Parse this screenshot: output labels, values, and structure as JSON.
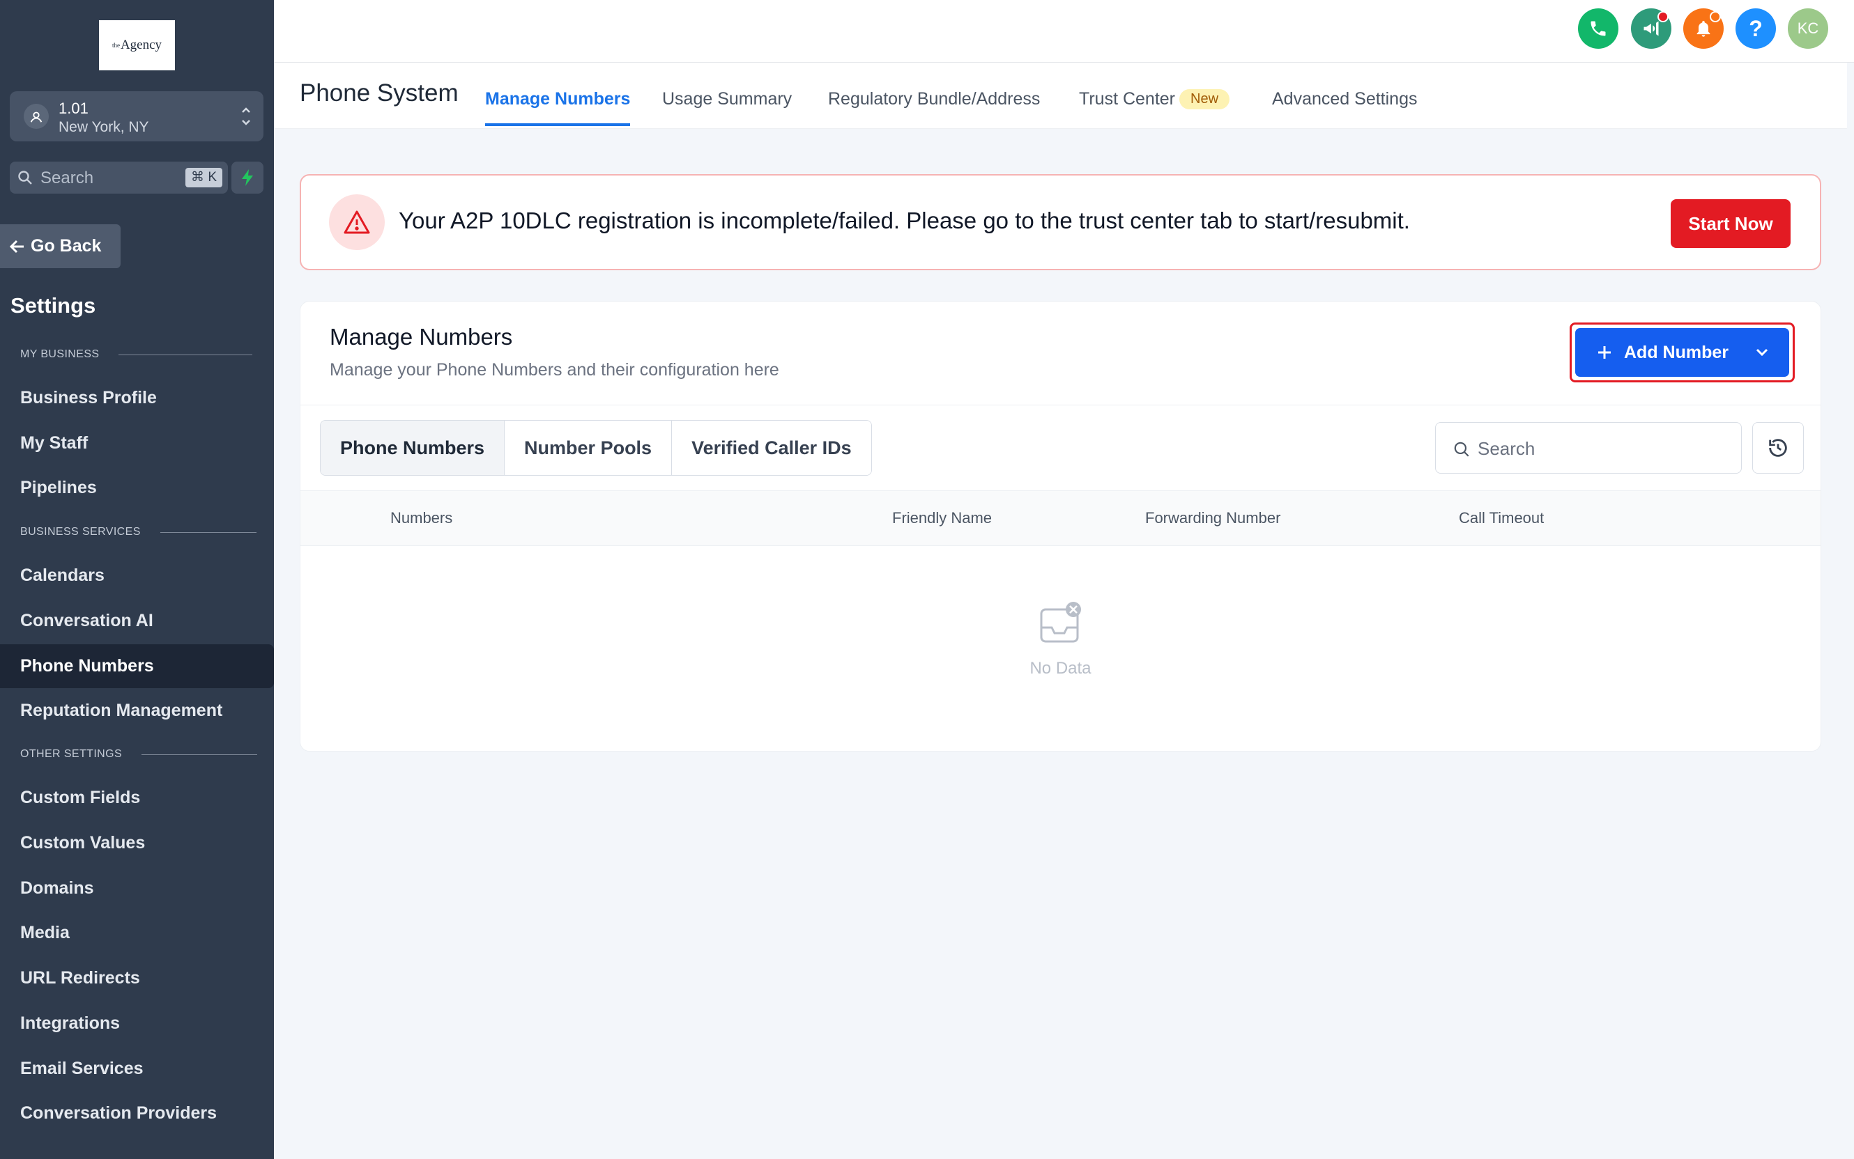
{
  "sidebar": {
    "logo_text": "Agency",
    "logo_sup": "the",
    "location": {
      "name": "1.01",
      "city": "New York, NY"
    },
    "search": {
      "placeholder": "Search",
      "shortcut": "⌘ K"
    },
    "go_back": "Go Back",
    "title": "Settings",
    "sections": [
      {
        "label": "MY BUSINESS"
      },
      {
        "label": "BUSINESS SERVICES"
      },
      {
        "label": "OTHER SETTINGS"
      }
    ],
    "items": [
      {
        "label": "Business Profile"
      },
      {
        "label": "My Staff"
      },
      {
        "label": "Pipelines"
      },
      {
        "label": "Calendars"
      },
      {
        "label": "Conversation AI"
      },
      {
        "label": "Phone Numbers",
        "active": true
      },
      {
        "label": "Reputation Management"
      },
      {
        "label": "Custom Fields"
      },
      {
        "label": "Custom Values"
      },
      {
        "label": "Domains"
      },
      {
        "label": "Media"
      },
      {
        "label": "URL Redirects"
      },
      {
        "label": "Integrations"
      },
      {
        "label": "Email Services"
      },
      {
        "label": "Conversation Providers"
      }
    ]
  },
  "header": {
    "icons": [
      {
        "name": "phone-icon",
        "color": "#12b76a"
      },
      {
        "name": "megaphone-icon",
        "color": "#2e9b7a"
      },
      {
        "name": "bell-icon",
        "color": "#f97316"
      },
      {
        "name": "help-icon",
        "color": "#1e90ff"
      },
      {
        "name": "avatar",
        "color": "#9cc98a"
      }
    ],
    "avatar_initials": "KC"
  },
  "subnav": {
    "title": "Phone System",
    "tabs": [
      {
        "label": "Manage Numbers",
        "active": true
      },
      {
        "label": "Usage Summary"
      },
      {
        "label": "Regulatory Bundle/Address"
      },
      {
        "label": "Trust Center",
        "badge": "New"
      },
      {
        "label": "Advanced Settings"
      }
    ]
  },
  "alert": {
    "message": "Your A2P 10DLC registration is incomplete/failed. Please go to the trust center tab to start/resubmit.",
    "button": "Start Now",
    "color": "#e31b23"
  },
  "card": {
    "title": "Manage Numbers",
    "subtitle": "Manage your Phone Numbers and their configuration here",
    "add_button": "Add Number",
    "segments": [
      {
        "label": "Phone Numbers",
        "active": true
      },
      {
        "label": "Number Pools"
      },
      {
        "label": "Verified Caller IDs"
      }
    ],
    "search_placeholder": "Search",
    "columns": [
      "Numbers",
      "Friendly Name",
      "Forwarding Number",
      "Call Timeout"
    ],
    "empty_text": "No Data"
  },
  "colors": {
    "sidebar_bg": "#2f3b4d",
    "accent": "#155eef",
    "danger": "#e31b23"
  }
}
